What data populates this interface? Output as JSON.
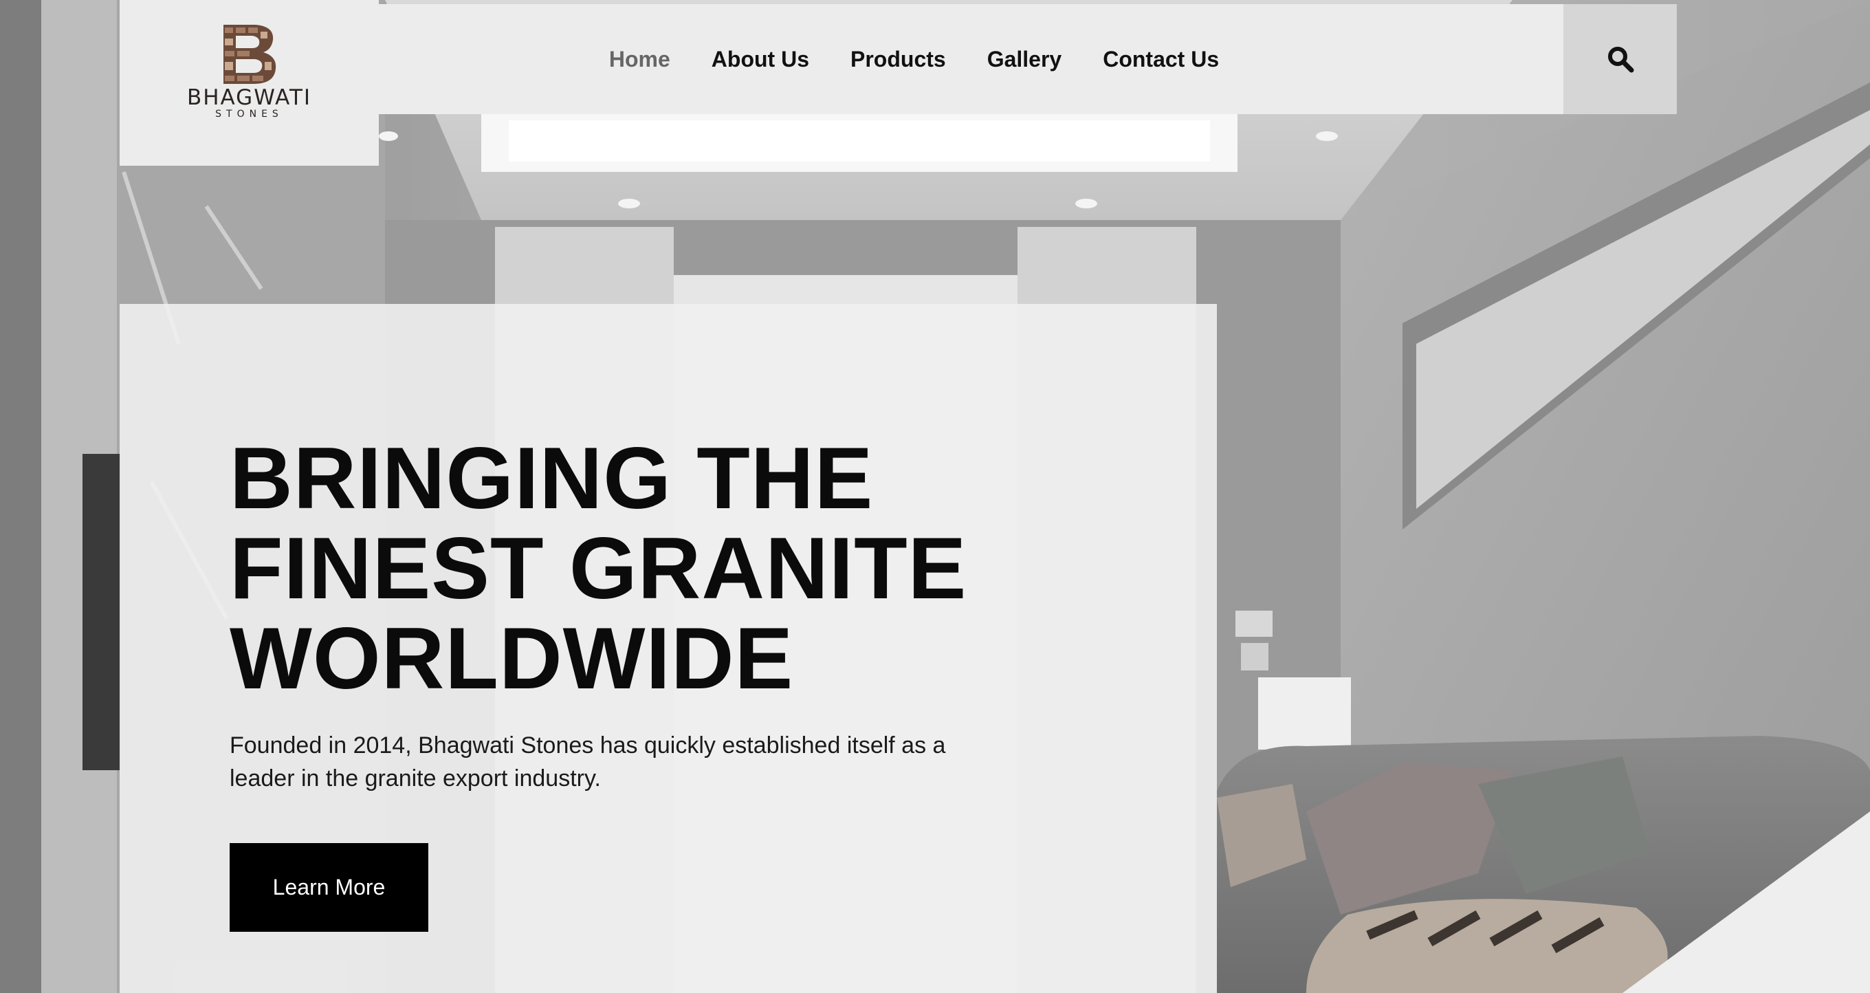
{
  "brand": {
    "name": "BHAGWATI",
    "tagline": "STONES",
    "logo_icon": "stone-letter-b-logo"
  },
  "nav": {
    "items": [
      {
        "label": "Home",
        "active": true
      },
      {
        "label": "About Us",
        "active": false
      },
      {
        "label": "Products",
        "active": false
      },
      {
        "label": "Gallery",
        "active": false
      },
      {
        "label": "Contact Us",
        "active": false
      }
    ],
    "search_icon": "search-icon"
  },
  "hero": {
    "title_lines": [
      "BRINGING THE",
      "FINEST GRANITE",
      "WORLDWIDE"
    ],
    "description": "Founded in 2014, Bhagwati Stones has quickly established itself as a leader in the granite export industry.",
    "cta_label": "Learn More"
  },
  "colors": {
    "panel_bg": "#f0f0f0",
    "nav_bg": "#ececec",
    "search_bg": "#d6d6d6",
    "button_bg": "#000000",
    "active_nav": "#666666",
    "text": "#0b0b0b"
  }
}
